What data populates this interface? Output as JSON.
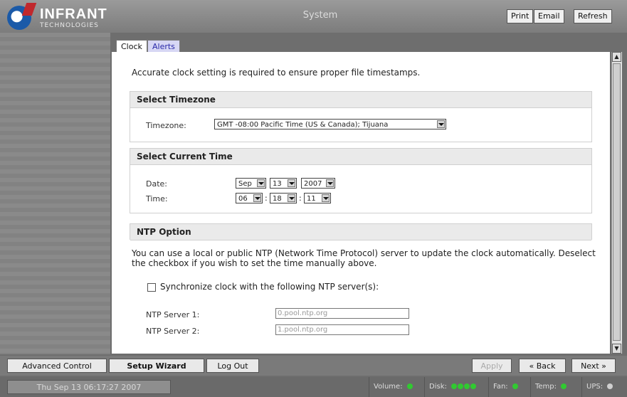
{
  "colors": {
    "led_ok": "#31c931",
    "led_off": "#cfcfcf"
  },
  "header": {
    "logo_name": "INFRANT",
    "logo_sub": "TECHNOLOGIES",
    "title": "System",
    "print_label": "Print",
    "email_label": "Email",
    "refresh_label": "Refresh"
  },
  "tabs": [
    {
      "label": "Clock"
    },
    {
      "label": "Alerts"
    }
  ],
  "intro": "Accurate clock setting is required to ensure proper file timestamps.",
  "timezone": {
    "section_title": "Select Timezone",
    "label": "Timezone:",
    "value": "GMT -08:00 Pacific Time (US & Canada); Tijuana"
  },
  "current_time": {
    "section_title": "Select Current Time",
    "date_label": "Date:",
    "month": "Sep",
    "day": "13",
    "year": "2007",
    "time_label": "Time:",
    "hour": "06",
    "minute": "18",
    "second": "11"
  },
  "ntp": {
    "section_title": "NTP Option",
    "description": "You can use a local or public NTP (Network Time Protocol) server to update the clock automatically. Deselect the checkbox if you wish to set the time manually above.",
    "checkbox_label": "Synchronize clock with the following NTP server(s):",
    "checked": false,
    "server1_label": "NTP Server 1:",
    "server1_value": "0.pool.ntp.org",
    "server2_label": "NTP Server 2:",
    "server2_value": "1.pool.ntp.org"
  },
  "bottom": {
    "advanced_control": "Advanced Control",
    "setup_wizard": "Setup Wizard",
    "log_out": "Log Out",
    "apply": "Apply",
    "back": "« Back",
    "next": "Next »"
  },
  "status": {
    "datetime": "Thu Sep 13 06:17:27 2007",
    "volume": "Volume:",
    "disk": "Disk:",
    "fan": "Fan:",
    "temp": "Temp:",
    "ups": "UPS:"
  }
}
